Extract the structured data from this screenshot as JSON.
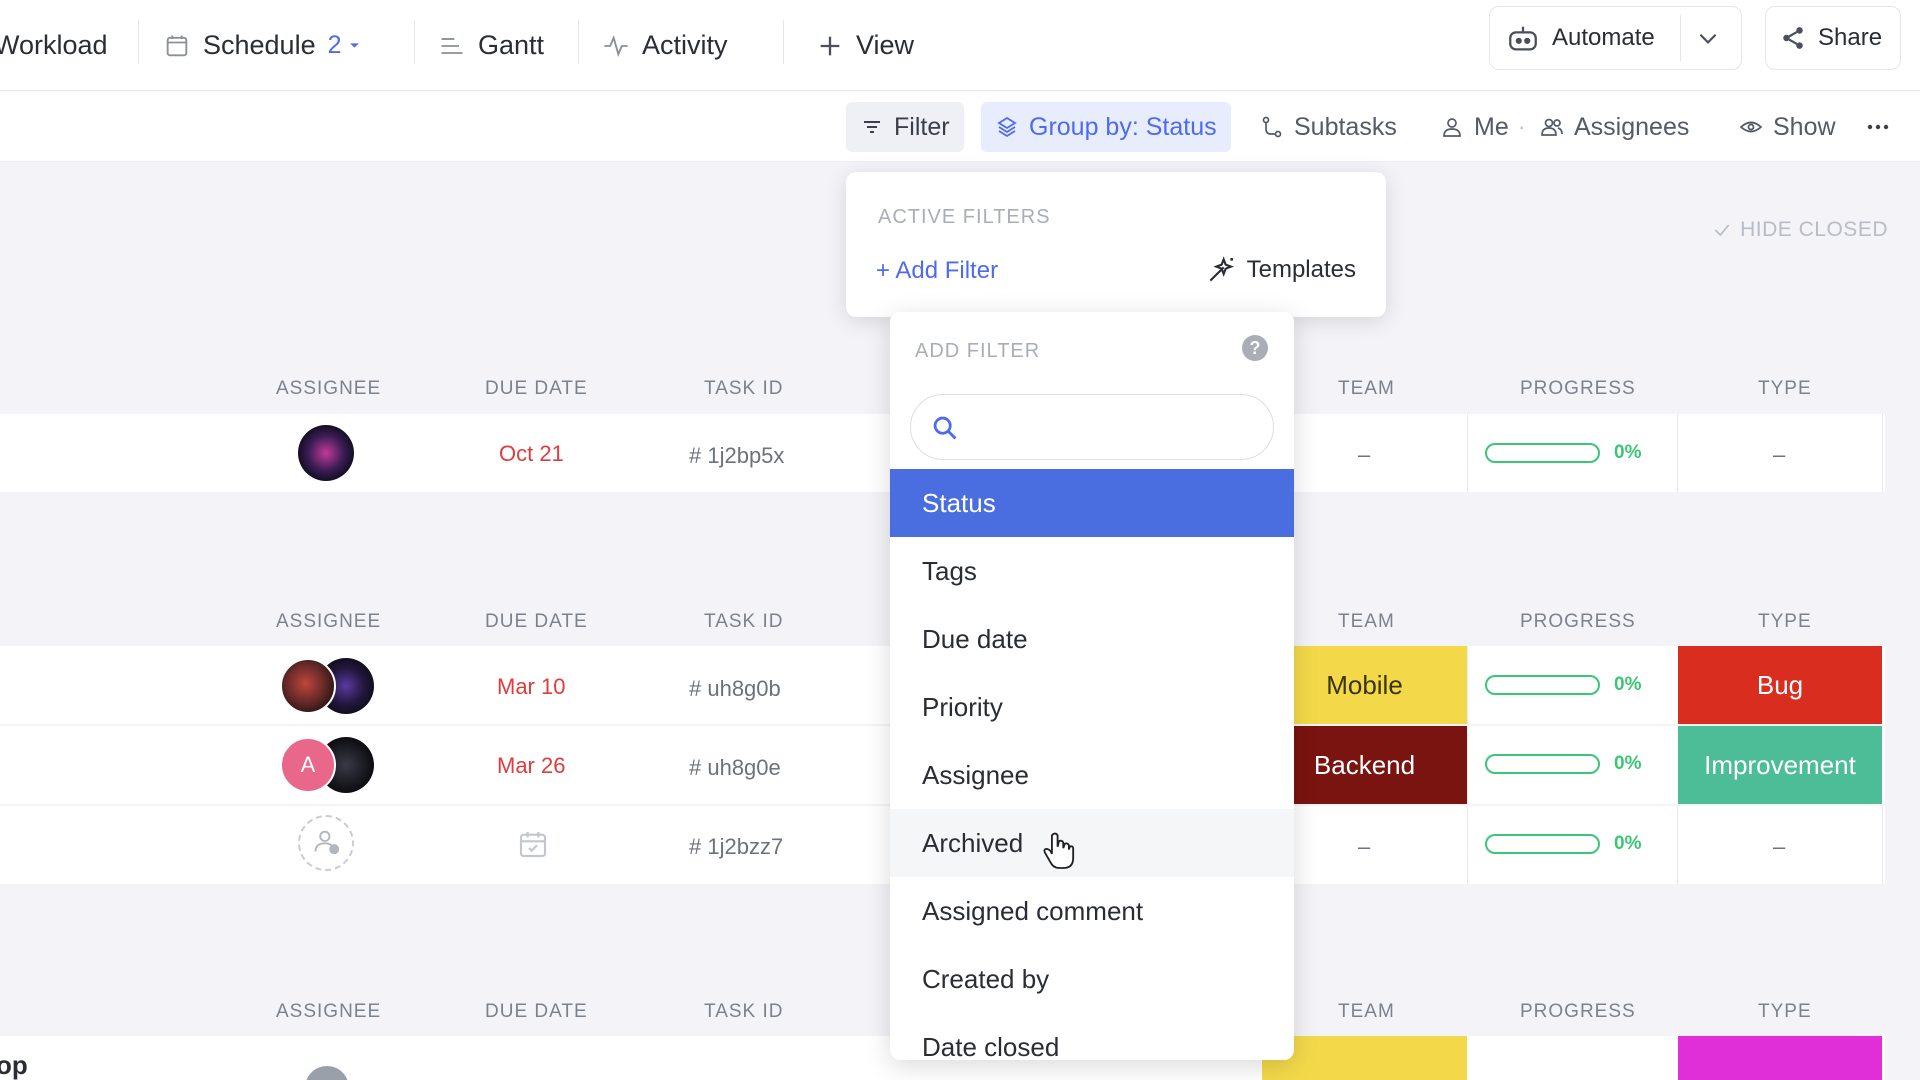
{
  "views": {
    "workload": "Workload",
    "schedule": "Schedule",
    "schedule_count": "2",
    "gantt": "Gantt",
    "activity": "Activity",
    "add_view": "View",
    "automate": "Automate",
    "share": "Share"
  },
  "toolbar": {
    "filter": "Filter",
    "group_by": "Group by: Status",
    "subtasks": "Subtasks",
    "me": "Me",
    "assignees": "Assignees",
    "show": "Show"
  },
  "list": {
    "hide_closed": "HIDE CLOSED",
    "columns": {
      "assignee": "ASSIGNEE",
      "due_date": "DUE DATE",
      "task_id": "TASK ID",
      "team": "TEAM",
      "progress": "PROGRESS",
      "type": "TYPE"
    },
    "rows": [
      {
        "due": "Oct 21",
        "task_id": "# 1j2bp5x",
        "team": "–",
        "progress": "0%",
        "type": "–"
      },
      {
        "due": "Mar 10",
        "task_id": "# uh8g0b",
        "team": "Mobile",
        "progress": "0%",
        "type": "Bug"
      },
      {
        "due": "Mar 26",
        "task_id": "# uh8g0e",
        "team": "Backend",
        "progress": "0%",
        "type": "Improvement",
        "avatar_letter": "A"
      },
      {
        "due": "",
        "task_id": "# 1j2bzz7",
        "team": "–",
        "progress": "0%",
        "type": "–"
      }
    ],
    "partial_row_text": "op"
  },
  "active_filters": {
    "title": "ACTIVE FILTERS",
    "add_filter": "+ Add Filter",
    "templates": "Templates"
  },
  "add_filter": {
    "title": "ADD FILTER",
    "help": "?",
    "search_placeholder": "",
    "options": [
      "Status",
      "Tags",
      "Due date",
      "Priority",
      "Assignee",
      "Archived",
      "Assigned comment",
      "Created by",
      "Date closed"
    ],
    "selected": "Status",
    "hovered": "Archived"
  },
  "colors": {
    "accent": "#4f6bed",
    "selected_option": "#4a6ee0",
    "due_red": "#e03c3c",
    "progress_green": "#3ac776",
    "team_mobile": "#f3d94a",
    "team_backend": "#7a1410",
    "type_bug": "#d92d20",
    "type_improvement": "#4dbd98",
    "type_magenta": "#e02fd9"
  }
}
